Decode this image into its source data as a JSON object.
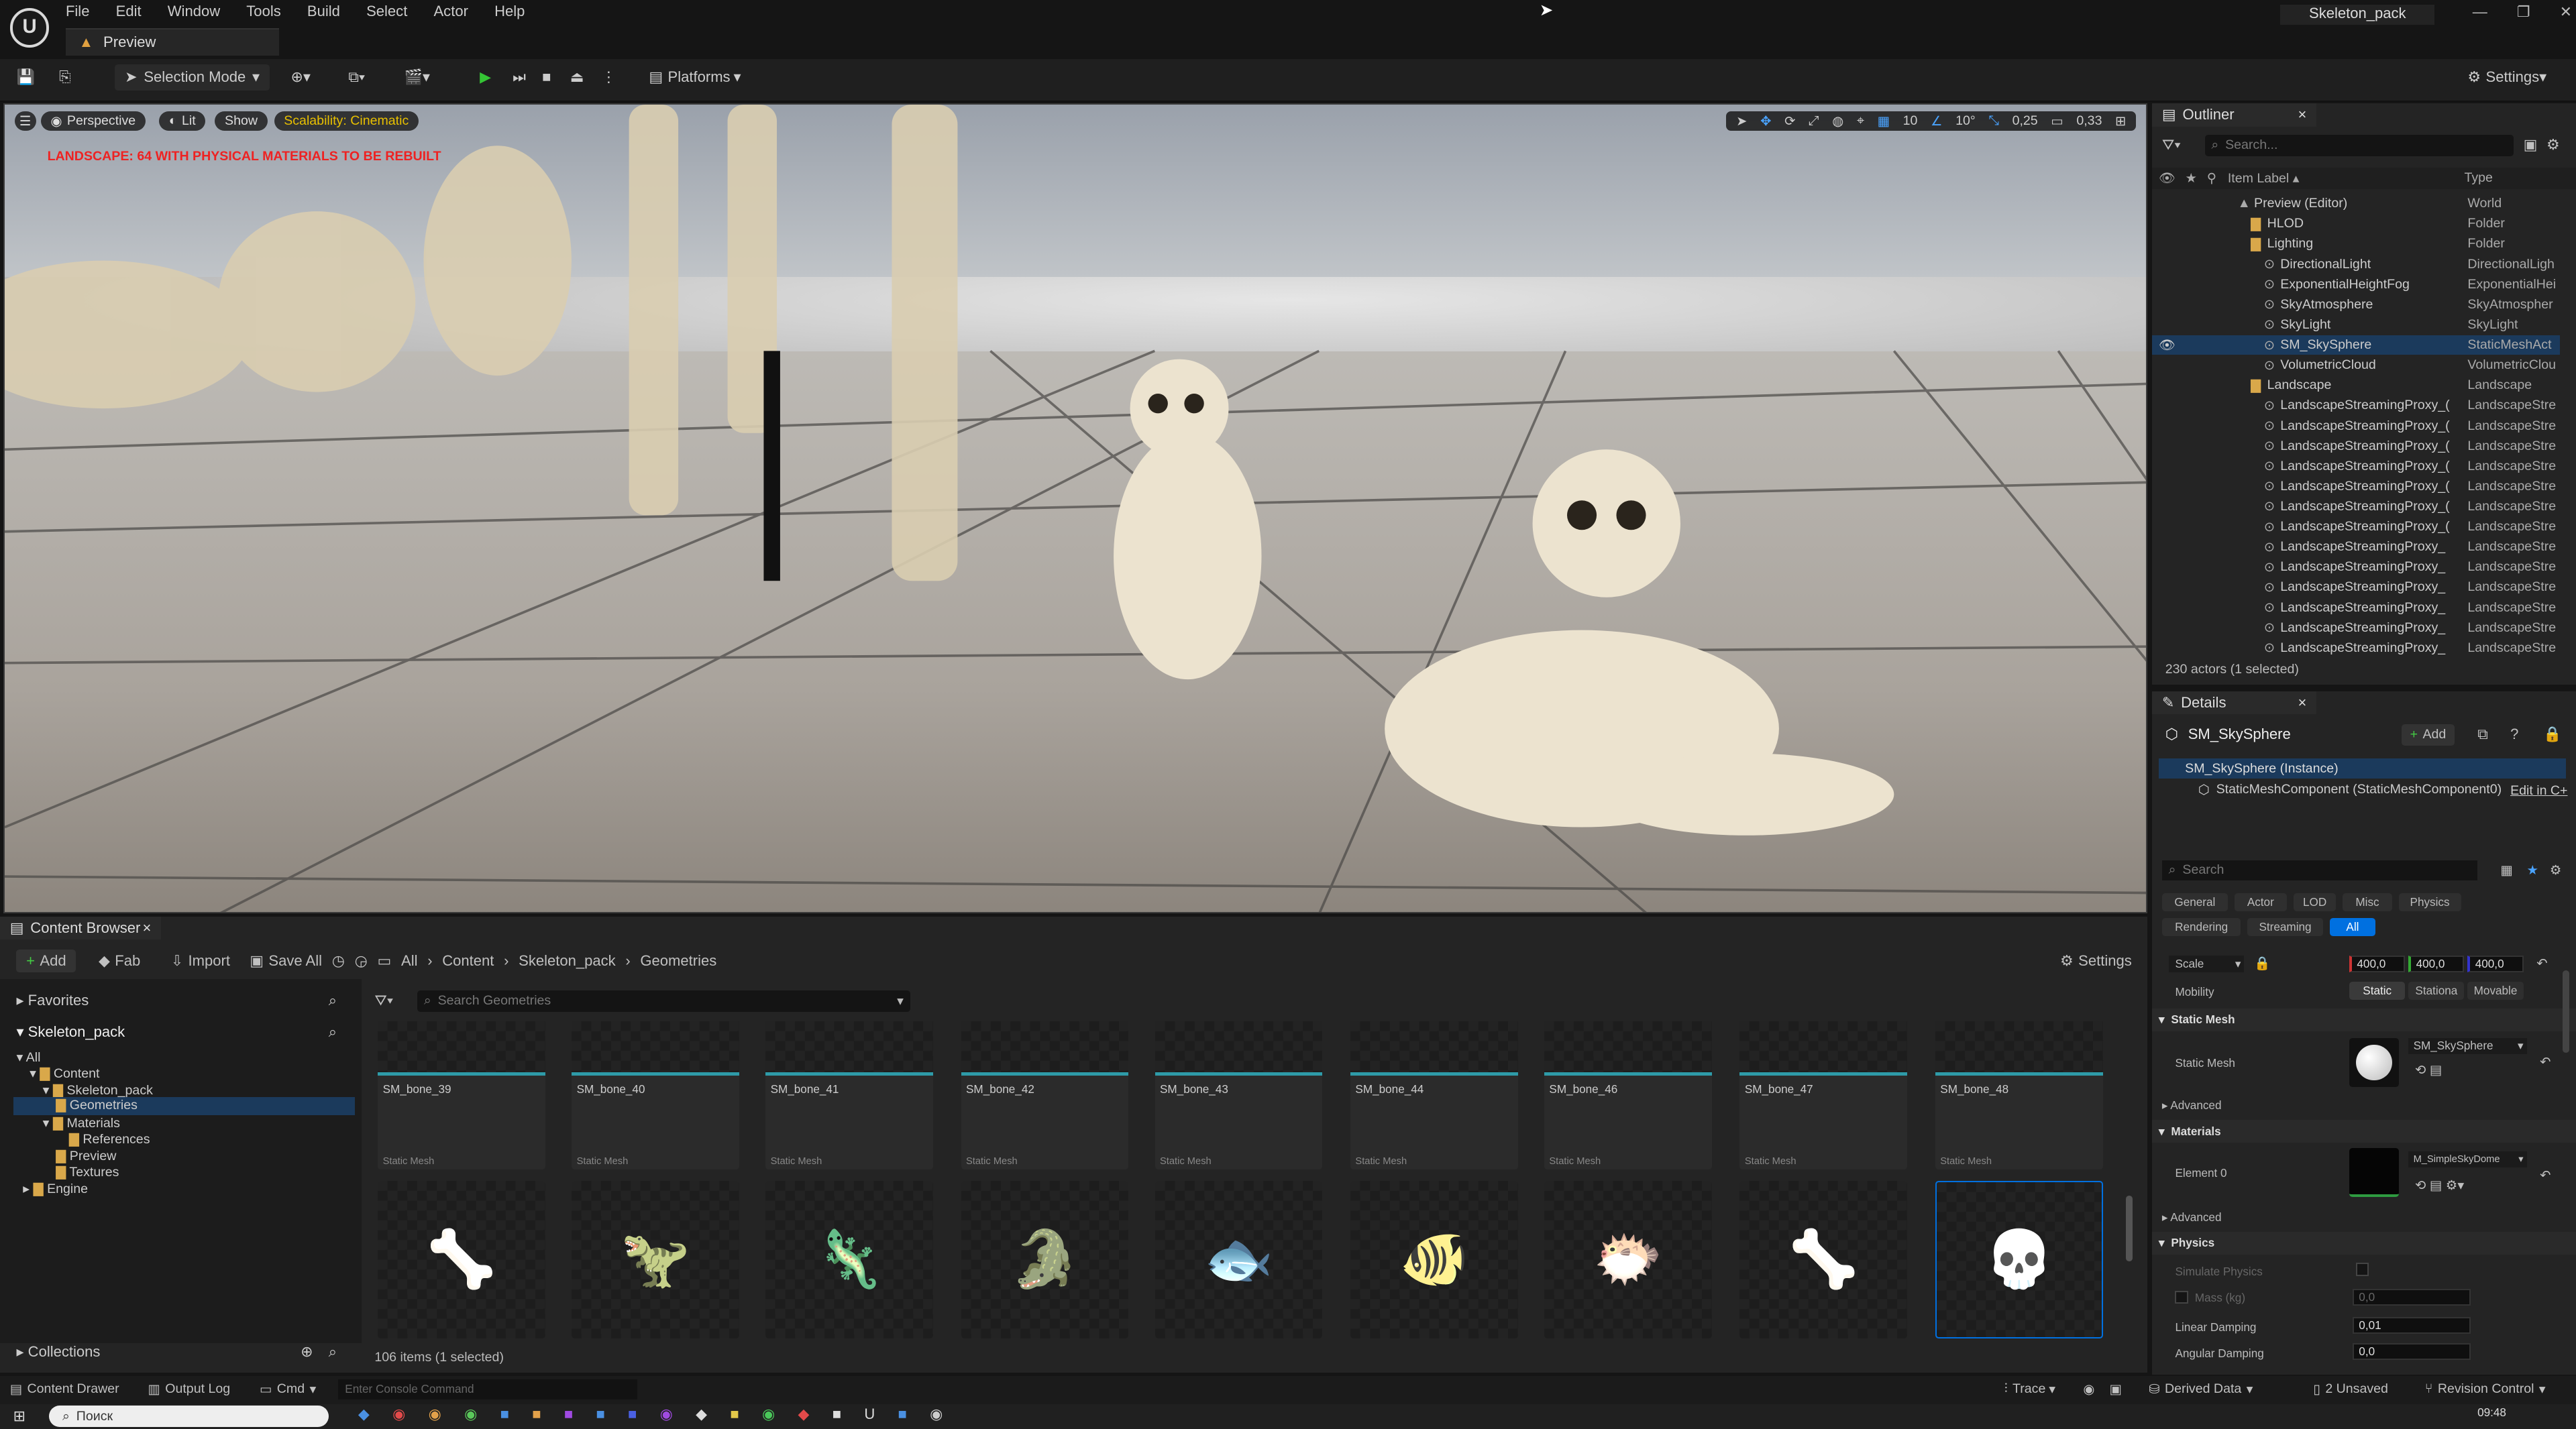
{
  "app": {
    "title_tab": "Preview",
    "project": "Skeleton_pack",
    "logo": "U"
  },
  "menu": [
    "File",
    "Edit",
    "Window",
    "Tools",
    "Build",
    "Select",
    "Actor",
    "Help"
  ],
  "toolbar": {
    "mode": "Selection Mode",
    "platforms": "Platforms",
    "settings": "Settings"
  },
  "viewport": {
    "perspective": "Perspective",
    "lit": "Lit",
    "show": "Show",
    "scalability": "Scalability: Cinematic",
    "warning": "LANDSCAPE: 64 WITH PHYSICAL MATERIALS TO BE REBUILT",
    "grid": "10",
    "angle": "10°",
    "scale": "0,25",
    "cam": "0,33"
  },
  "outliner": {
    "tab": "Outliner",
    "search_placeholder": "Search...",
    "col_label": "Item Label ▴",
    "col_type": "Type",
    "rows": [
      {
        "label": "Preview (Editor)",
        "type": "World"
      },
      {
        "label": "HLOD",
        "type": "Folder"
      },
      {
        "label": "Lighting",
        "type": "Folder"
      },
      {
        "label": "DirectionalLight",
        "type": "DirectionalLigh"
      },
      {
        "label": "ExponentialHeightFog",
        "type": "ExponentialHei"
      },
      {
        "label": "SkyAtmosphere",
        "type": "SkyAtmospher"
      },
      {
        "label": "SkyLight",
        "type": "SkyLight"
      },
      {
        "label": "SM_SkySphere",
        "type": "StaticMeshAct"
      },
      {
        "label": "VolumetricCloud",
        "type": "VolumetricClou"
      },
      {
        "label": "Landscape",
        "type": "Landscape"
      },
      {
        "label": "LandscapeStreamingProxy_(",
        "type": "LandscapeStre"
      },
      {
        "label": "LandscapeStreamingProxy_(",
        "type": "LandscapeStre"
      },
      {
        "label": "LandscapeStreamingProxy_(",
        "type": "LandscapeStre"
      },
      {
        "label": "LandscapeStreamingProxy_(",
        "type": "LandscapeStre"
      },
      {
        "label": "LandscapeStreamingProxy_(",
        "type": "LandscapeStre"
      },
      {
        "label": "LandscapeStreamingProxy_(",
        "type": "LandscapeStre"
      },
      {
        "label": "LandscapeStreamingProxy_(",
        "type": "LandscapeStre"
      },
      {
        "label": "LandscapeStreamingProxy_",
        "type": "LandscapeStre"
      },
      {
        "label": "LandscapeStreamingProxy_",
        "type": "LandscapeStre"
      },
      {
        "label": "LandscapeStreamingProxy_",
        "type": "LandscapeStre"
      },
      {
        "label": "LandscapeStreamingProxy_",
        "type": "LandscapeStre"
      },
      {
        "label": "LandscapeStreamingProxy_",
        "type": "LandscapeStre"
      },
      {
        "label": "LandscapeStreamingProxy_",
        "type": "LandscapeStre"
      }
    ],
    "status": "230 actors (1 selected)"
  },
  "details": {
    "tab": "Details",
    "actor": "SM_SkySphere",
    "add": "Add",
    "instance": "SM_SkySphere (Instance)",
    "component": "StaticMeshComponent (StaticMeshComponent0)",
    "edit_in": "Edit in C+",
    "search_placeholder": "Search",
    "filters_row1": [
      "General",
      "Actor",
      "LOD",
      "Misc",
      "Physics"
    ],
    "filters_row2": [
      "Rendering",
      "Streaming",
      "All"
    ],
    "scale_label": "Scale",
    "scale": [
      "400,0",
      "400,0",
      "400,0"
    ],
    "mobility_label": "Mobility",
    "mobility": [
      "Static",
      "Stationa",
      "Movable"
    ],
    "sec_static_mesh": "Static Mesh",
    "static_mesh_label": "Static Mesh",
    "static_mesh_value": "SM_SkySphere",
    "advanced": "Advanced",
    "sec_materials": "Materials",
    "element0": "Element 0",
    "material_value": "M_SimpleSkyDome",
    "sec_physics": "Physics",
    "simulate": "Simulate Physics",
    "mass": "Mass (kg)",
    "mass_value": "0,0",
    "linear_damping": "Linear Damping",
    "linear_value": "0,01",
    "angular_damping": "Angular Damping",
    "angular_value": "0,0"
  },
  "content_browser": {
    "tab": "Content Browser",
    "add": "Add",
    "fab": "Fab",
    "import": "Import",
    "save_all": "Save All",
    "breadcrumb": [
      "All",
      "Content",
      "Skeleton_pack",
      "Geometries"
    ],
    "settings": "Settings",
    "favorites": "Favorites",
    "pack": "Skeleton_pack",
    "search_placeholder": "Search Geometries",
    "tree": [
      "All",
      "Content",
      "Skeleton_pack",
      "Geometries",
      "Materials",
      "References",
      "Preview",
      "Textures",
      "Engine"
    ],
    "collections": "Collections",
    "assets_row1": [
      "SM_bone_39",
      "SM_bone_40",
      "SM_bone_41",
      "SM_bone_42",
      "SM_bone_43",
      "SM_bone_44",
      "SM_bone_46",
      "SM_bone_47",
      "SM_bone_48"
    ],
    "asset_kind": "Static Mesh",
    "count": "106 items (1 selected)"
  },
  "statusbar": {
    "drawer": "Content Drawer",
    "output": "Output Log",
    "cmd": "Cmd",
    "console_placeholder": "Enter Console Command",
    "trace": "Trace",
    "derived": "Derived Data",
    "unsaved": "2 Unsaved",
    "revision": "Revision Control"
  },
  "taskbar": {
    "search": "Поиск",
    "time": "09:48"
  },
  "colors": {
    "accent": "#0070e0",
    "cinematic": "#e8c000",
    "selection": "#1b3a5c",
    "teal": "#2e9ba8"
  }
}
